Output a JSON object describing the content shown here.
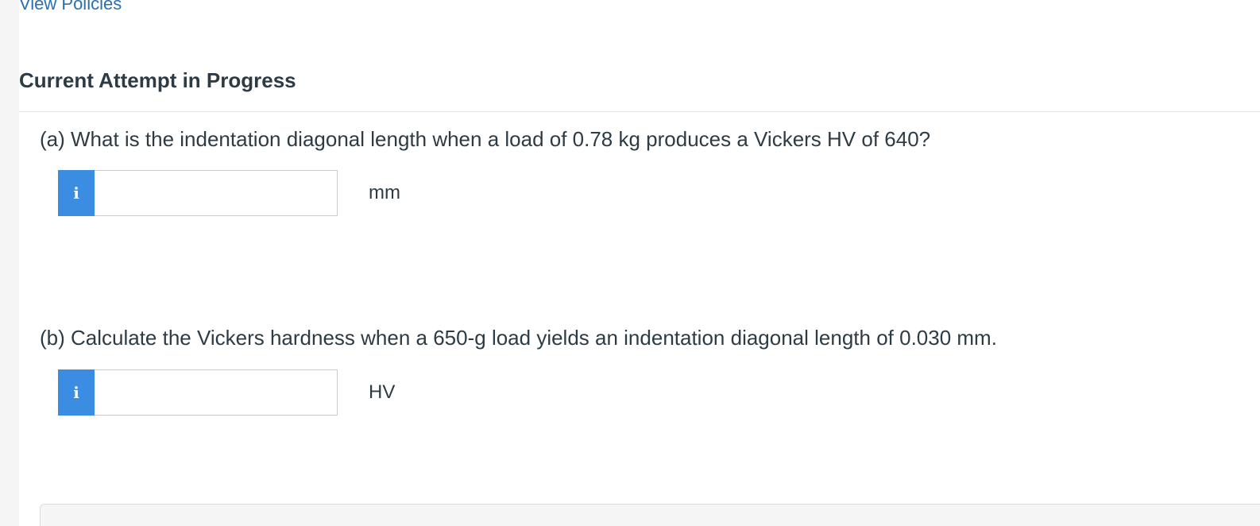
{
  "header": {
    "policies_link": "View Policies",
    "attempt_heading": "Current Attempt in Progress"
  },
  "questions": [
    {
      "text": "(a) What is the indentation diagonal length when a load of 0.78 kg produces a Vickers HV of 640?",
      "info_icon": "i",
      "input_value": "",
      "unit": "mm"
    },
    {
      "text": "(b) Calculate the Vickers hardness when a 650-g load yields an indentation diagonal length of 0.030 mm.",
      "info_icon": "i",
      "input_value": "",
      "unit": "HV"
    }
  ],
  "colors": {
    "link": "#2a6fb0",
    "info_button": "#3a8de0",
    "text": "#2d3b45"
  },
  "icons": {
    "info": "info-icon"
  }
}
